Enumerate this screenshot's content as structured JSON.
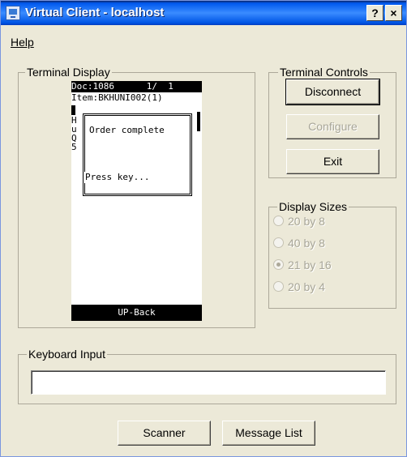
{
  "window": {
    "title": "Virtual Client - localhost",
    "help_button": "?",
    "close_button": "×"
  },
  "menu": {
    "help": "Help"
  },
  "terminal_display": {
    "group_label": "Terminal Display",
    "header": "Doc:1086      1/  1",
    "item": "Item:BKHUNI002(1)",
    "side_chars": [
      "H",
      "u",
      "Q",
      "5"
    ],
    "popup_message": "Order complete",
    "popup_footer": "Press key...",
    "bottom_bar": "UP-Back"
  },
  "terminal_controls": {
    "group_label": "Terminal Controls",
    "disconnect": "Disconnect",
    "configure": "Configure",
    "exit": "Exit"
  },
  "display_sizes": {
    "group_label": "Display Sizes",
    "options": [
      {
        "label": "20 by 8",
        "selected": false
      },
      {
        "label": "40 by 8",
        "selected": false
      },
      {
        "label": "21 by 16",
        "selected": true
      },
      {
        "label": "20 by 4",
        "selected": false
      }
    ]
  },
  "keyboard_input": {
    "group_label": "Keyboard Input",
    "value": ""
  },
  "footer": {
    "scanner": "Scanner",
    "message_list": "Message List"
  }
}
